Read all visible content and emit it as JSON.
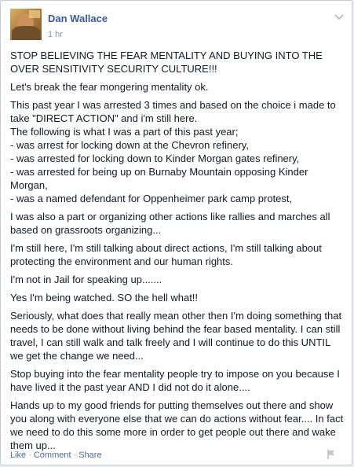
{
  "post": {
    "author": "Dan Wallace",
    "time": "1 hr",
    "paragraphs": [
      "STOP BELIEVING THE FEAR MENTALITY AND BUYING INTO THE OVER SENSITIVITY SECURITY CULTURE!!!",
      "Let's break the fear mongering mentality ok.",
      "This past year I was arrested 3 times and based on the choice i made to take \"DIRECT ACTION\" and i'm still here.\nThe following is what I was a part of this past year;\n- was arrest for locking down at the Chevron refinery,\n- was arrested for locking down to Kinder Morgan gates refinery,\n- was arrested for being up on Burnaby Mountain opposing Kinder Morgan,\n- was a named defendant for Oppenheimer park camp protest,",
      "I was also a part or organizing other actions like rallies and marches all based on grassroots organizing...",
      "I'm still here, I'm still talking about direct actions, I'm still talking about protecting the environment and our human rights.",
      "I'm not in Jail for speaking up.......",
      "Yes I'm being watched. SO the hell what!!",
      "Seriously, what does that really mean other then I'm doing something that needs to be done without living behind the fear based mentality. I can still travel, I can still walk and talk freely and I will continue to do this UNTIL we get the change we need...",
      "Stop buying into the fear mentality people try to impose on you because I have lived it the past year AND I did not do it alone....",
      "Hands up to my good friends for putting themselves out there and show you along with everyone else that we can do actions without fear.... In fact we need to do this some more in order to get people out there and wake them up..."
    ]
  },
  "footer": {
    "like": "Like",
    "comment": "Comment",
    "share": "Share",
    "separator": "·"
  },
  "icons": {
    "options": "chevron-down-icon",
    "report": "flag-icon"
  },
  "colors": {
    "link": "#3b5998",
    "text": "#141823",
    "meta": "#9197a3"
  }
}
